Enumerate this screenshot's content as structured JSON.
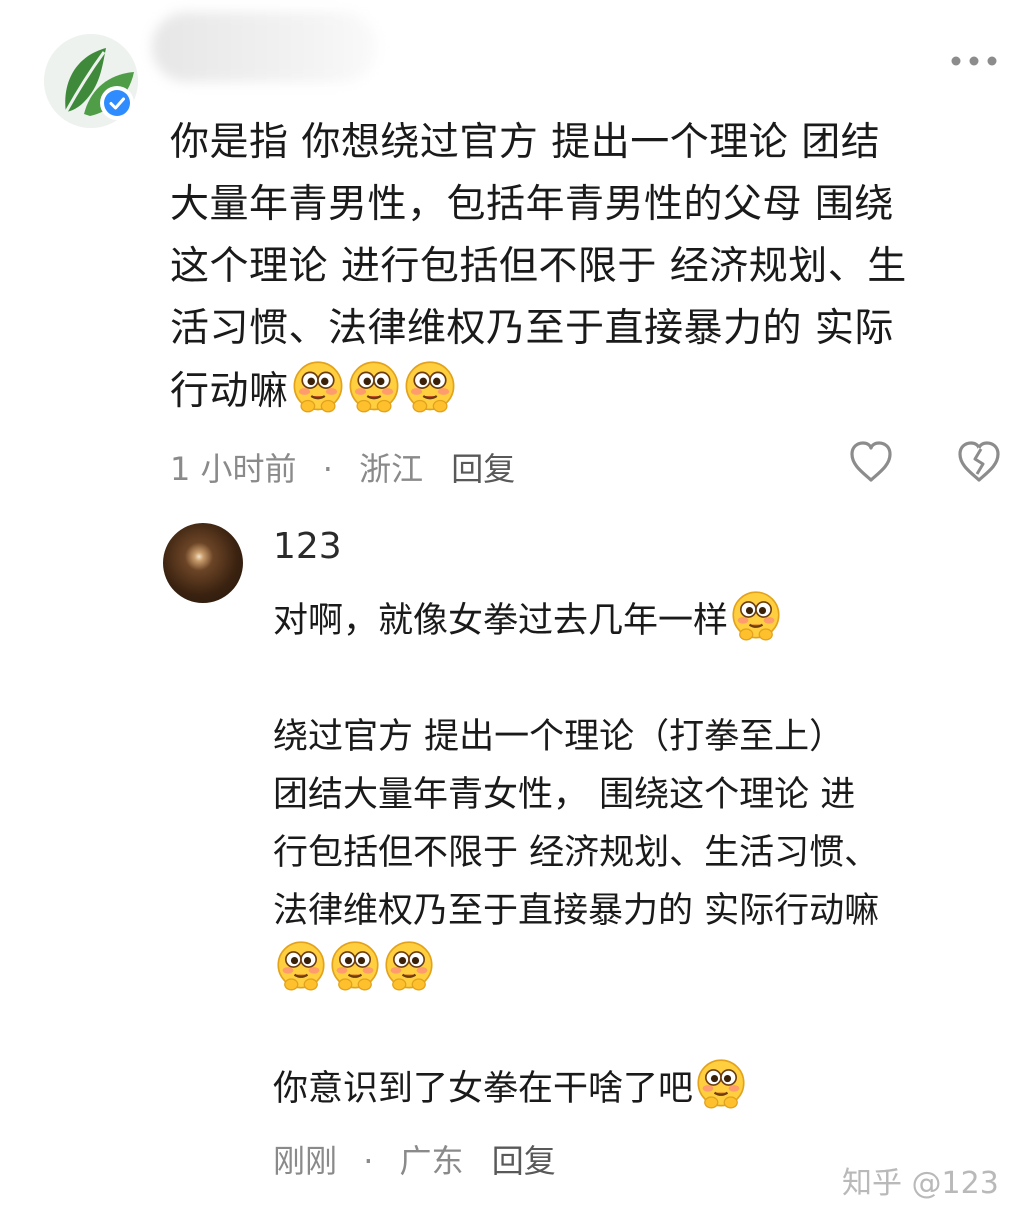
{
  "comment": {
    "text_lines": [
      "你是指 你想绕过官方 提出一个理论 团结",
      "大量年青男性，包括年青男性的父母 围绕",
      "这个理论 进行包括但不限于 经济规划、生",
      "活习惯、法律维权乃至于直接暴力的 实际",
      "行动嘛"
    ],
    "emoji_count": 3,
    "time": "1 小时前",
    "separator": "·",
    "location": "浙江",
    "reply_label": "回复",
    "icons": [
      "more-icon",
      "heart-icon",
      "dislike-icon",
      "verified-icon"
    ]
  },
  "reply": {
    "username": "123",
    "paragraphs": [
      {
        "lines": [
          "对啊，就像女拳过去几年一样"
        ],
        "emoji_count": 1
      },
      {
        "lines": [
          "绕过官方 提出一个理论（打拳至上）",
          "团结大量年青女性， 围绕这个理论 进",
          "行包括但不限于 经济规划、生活习惯、",
          "法律维权乃至于直接暴力的 实际行动嘛"
        ],
        "emoji_count": 3,
        "emoji_newline": true
      },
      {
        "lines": [
          "你意识到了女拳在干啥了吧"
        ],
        "emoji_count": 1
      }
    ],
    "time": "刚刚",
    "separator": "·",
    "location": "广东",
    "reply_label": "回复"
  },
  "watermark": "知乎 @123",
  "colors": {
    "verified_blue": "#2f8cff",
    "leaf_green": "#3e8a3a",
    "meta_gray": "#8a8a8a"
  }
}
